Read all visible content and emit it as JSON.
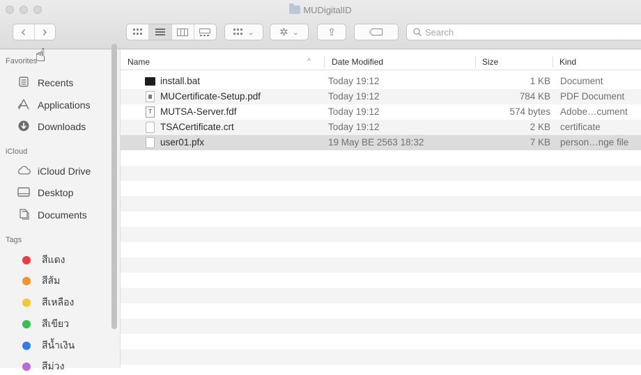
{
  "window": {
    "title": "MUDigitalID"
  },
  "toolbar": {
    "search_placeholder": "Search",
    "back_label": "‹",
    "forward_label": "›",
    "share_glyph": "⇪",
    "gear_glyph": "✲",
    "chevron": "⌄"
  },
  "sidebar": {
    "sections": [
      {
        "heading": "Favorites"
      },
      {
        "heading": "iCloud"
      },
      {
        "heading": "Tags"
      }
    ],
    "favorites": [
      {
        "label": "Recents",
        "icon": "recents-icon"
      },
      {
        "label": "Applications",
        "icon": "applications-icon"
      },
      {
        "label": "Downloads",
        "icon": "downloads-icon"
      }
    ],
    "icloud": [
      {
        "label": "iCloud Drive",
        "icon": "cloud-icon"
      },
      {
        "label": "Desktop",
        "icon": "desktop-icon"
      },
      {
        "label": "Documents",
        "icon": "documents-icon"
      }
    ],
    "tags": [
      {
        "label": "สีแดง",
        "color": "#f23b3b"
      },
      {
        "label": "สีส้ม",
        "color": "#f5922c"
      },
      {
        "label": "สีเหลือง",
        "color": "#f5c82e"
      },
      {
        "label": "สีเขียว",
        "color": "#33c151"
      },
      {
        "label": "สีน้ำเงิน",
        "color": "#2f7bf0"
      },
      {
        "label": "สีม่วง",
        "color": "#b96ad6"
      }
    ]
  },
  "columns": {
    "name": "Name",
    "date": "Date Modified",
    "size": "Size",
    "kind": "Kind"
  },
  "files": [
    {
      "name": "install.bat",
      "date": "Today 19:12",
      "size": "1 KB",
      "kind": "Document",
      "icon": "terminal-file-icon"
    },
    {
      "name": "MUCertificate-Setup.pdf",
      "date": "Today 19:12",
      "size": "784 KB",
      "kind": "PDF Document",
      "icon": "pdf-file-icon"
    },
    {
      "name": "MUTSA-Server.fdf",
      "date": "Today 19:12",
      "size": "574 bytes",
      "kind": "Adobe…cument",
      "icon": "fdf-file-icon"
    },
    {
      "name": "TSACertificate.crt",
      "date": "Today 19:12",
      "size": "2 KB",
      "kind": "certificate",
      "icon": "blank-file-icon"
    },
    {
      "name": "user01.pfx",
      "date": "19 May BE 2563 18:32",
      "size": "7 KB",
      "kind": "person…nge file",
      "icon": "blank-file-icon"
    }
  ]
}
